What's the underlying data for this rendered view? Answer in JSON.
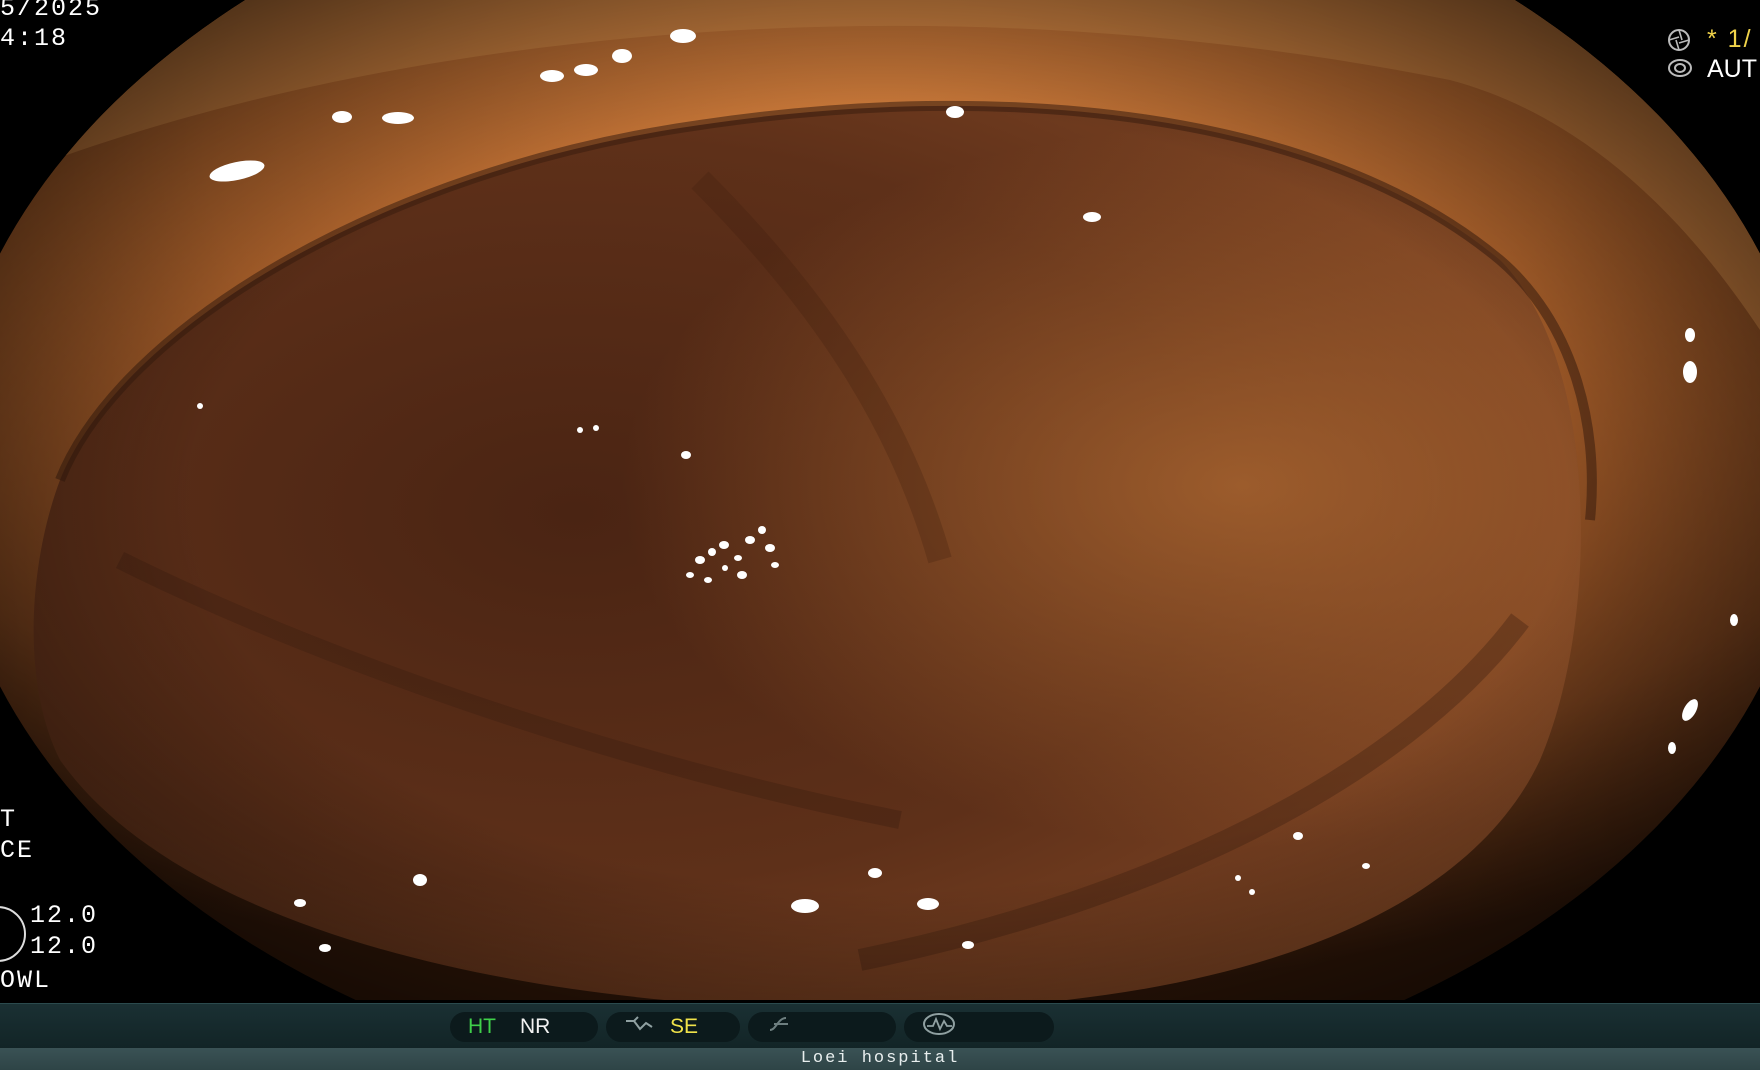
{
  "overlay": {
    "date": "5/2025",
    "time": "4:18",
    "zoom_indicator": "* 1/",
    "exposure_mode": "AUT",
    "left_label_1": "T",
    "left_label_2": "CE",
    "value_1": "12.0",
    "value_2": "12.0",
    "left_label_3": "OWL"
  },
  "status_bar": {
    "ht_label": "HT",
    "nr_label": "NR",
    "se_label": "SE",
    "colors": {
      "ht": "#3fd04a",
      "se": "#f0e34a",
      "dim_icon": "#6e7f80"
    },
    "icons": [
      "structure-enhance-icon",
      "color-enhance-icon",
      "waveform-icon"
    ]
  },
  "footer": {
    "hospital": "Loei hospital"
  }
}
